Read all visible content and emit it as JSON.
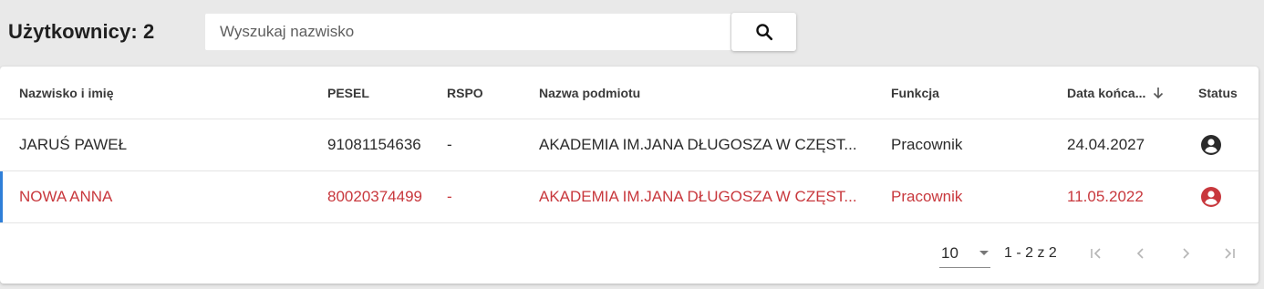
{
  "header": {
    "title": "Użytkownicy: 2",
    "search_placeholder": "Wyszukaj nazwisko",
    "search_icon": "search-icon"
  },
  "table": {
    "columns": [
      "Nazwisko i imię",
      "PESEL",
      "RSPO",
      "Nazwa podmiotu",
      "Funkcja",
      "Data końca...",
      "Status"
    ],
    "sort_icon": "arrow-down-icon",
    "rows": [
      {
        "name": "JARUŚ PAWEŁ",
        "pesel": "91081154636",
        "rspo": "-",
        "organization": "AKADEMIA IM.JANA DŁUGOSZA W CZĘST...",
        "function": "Pracownik",
        "end_date": "24.04.2027",
        "status_icon": "user-account-icon",
        "status_color": "#2b2b2b"
      },
      {
        "name": "NOWA ANNA",
        "pesel": "80020374499",
        "rspo": "-",
        "organization": "AKADEMIA IM.JANA DŁUGOSZA W CZĘST...",
        "function": "Pracownik",
        "end_date": "11.05.2022",
        "status_icon": "user-account-icon",
        "status_color": "#c8383d"
      }
    ]
  },
  "pagination": {
    "page_size": "10",
    "range": "1 - 2 z 2",
    "first_icon": "first-page-icon",
    "prev_icon": "chevron-left-icon",
    "next_icon": "chevron-right-icon",
    "last_icon": "last-page-icon"
  },
  "colors": {
    "expired_row": "#c8383d",
    "selected_indicator": "#2f7fd8"
  }
}
